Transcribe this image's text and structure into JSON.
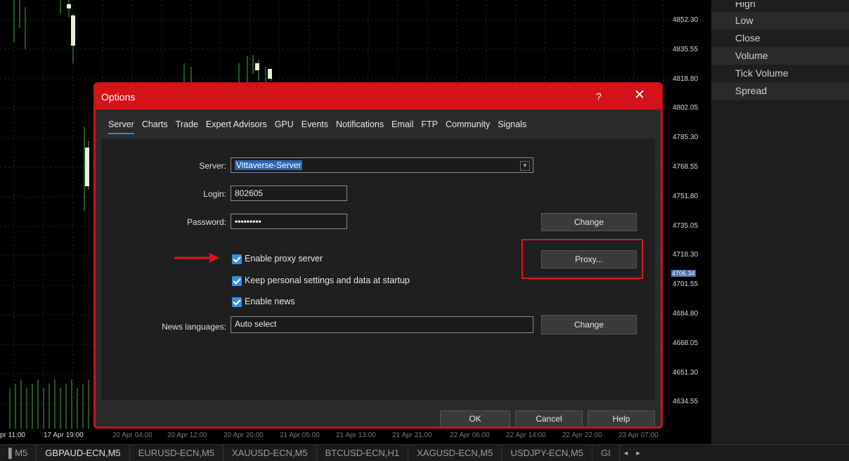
{
  "chart": {
    "prices": [
      "4852.30",
      "4835.55",
      "4818.80",
      "4802.05",
      "4785.30",
      "4768.55",
      "4751.80",
      "4735.05",
      "4718.30",
      "4701.55",
      "4684.80",
      "4668.05",
      "4651.30",
      "4634.55"
    ],
    "current_price": "4706.34",
    "time_labels": [
      "pr 11:00",
      "17 Apr 19:00",
      "20 Apr 04:00",
      "20 Apr 12:00",
      "20 Apr 20:00",
      "21 Apr 05:00",
      "21 Apr 13:00",
      "21 Apr 21:00",
      "22 Apr 06:00",
      "22 Apr 14:00",
      "22 Apr 22:00",
      "23 Apr 07:00"
    ]
  },
  "right_panel": {
    "items": [
      "High",
      "Low",
      "Close",
      "Volume",
      "Tick Volume",
      "Spread"
    ]
  },
  "symbol_tabs": [
    "▌M5",
    "GBPAUD-ECN,M5",
    "EURUSD-ECN,M5",
    "XAUUSD-ECN,M5",
    "BTCUSD-ECN,H1",
    "XAGUSD-ECN,M5",
    "USDJPY-ECN,M5",
    "GI"
  ],
  "tab_arrows": {
    "left": "◂",
    "right": "▸"
  },
  "dialog": {
    "title": "Options",
    "help": "?",
    "close": "✕",
    "tabs": [
      "Server",
      "Charts",
      "Trade",
      "Expert Advisors",
      "GPU",
      "Events",
      "Notifications",
      "Email",
      "FTP",
      "Community",
      "Signals"
    ],
    "active_tab": "Server",
    "server_label": "Server:",
    "server_value": "Vittaverse-Server",
    "login_label": "Login:",
    "login_value": "802605",
    "password_label": "Password:",
    "password_value": "•••••••••",
    "change_label": "Change",
    "proxy_label": "Proxy...",
    "checkboxes": {
      "proxy": "Enable proxy server",
      "keep": "Keep personal settings and data at startup",
      "news": "Enable news"
    },
    "news_lang_label": "News languages:",
    "news_lang_value": "Auto select",
    "ok": "OK",
    "cancel": "Cancel",
    "help_btn": "Help"
  },
  "colors": {
    "title_bar": "#d41418",
    "accent": "#3b8ee0",
    "annotation": "#e0131a",
    "bull_candle": "#e9efd8",
    "wick": "#3fae3f"
  }
}
